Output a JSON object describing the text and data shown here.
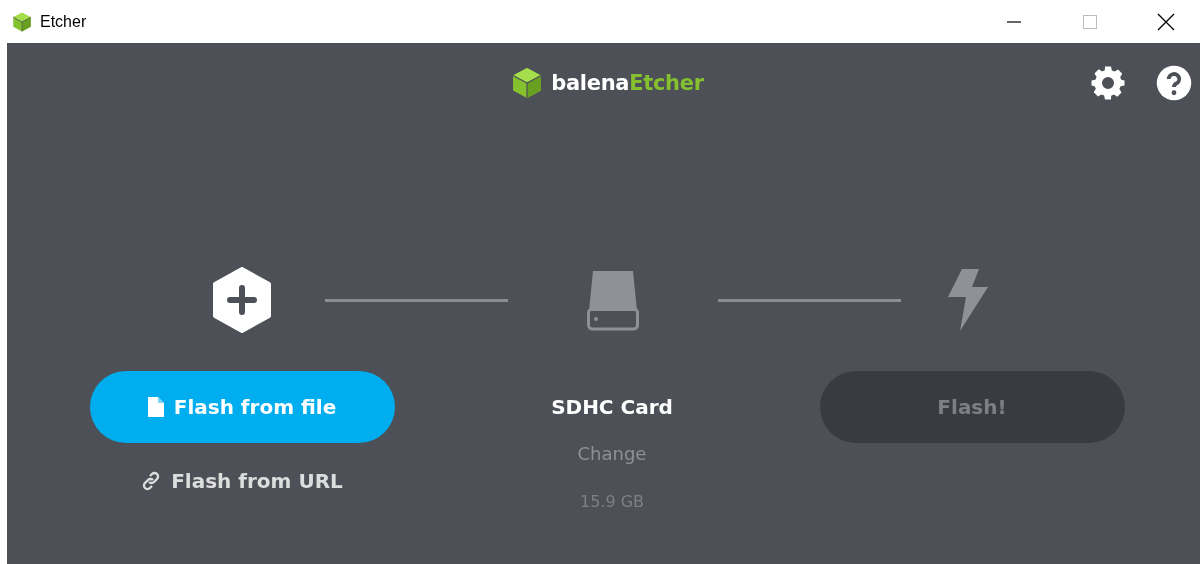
{
  "window": {
    "title": "Etcher"
  },
  "logo": {
    "prefix": "balena",
    "suffix": "Etcher"
  },
  "source": {
    "primary_button": "Flash from file",
    "link": "Flash from URL"
  },
  "target": {
    "name": "SDHC Card",
    "change": "Change",
    "size": "15.9 GB"
  },
  "flash": {
    "label": "Flash!",
    "disabled": true
  }
}
